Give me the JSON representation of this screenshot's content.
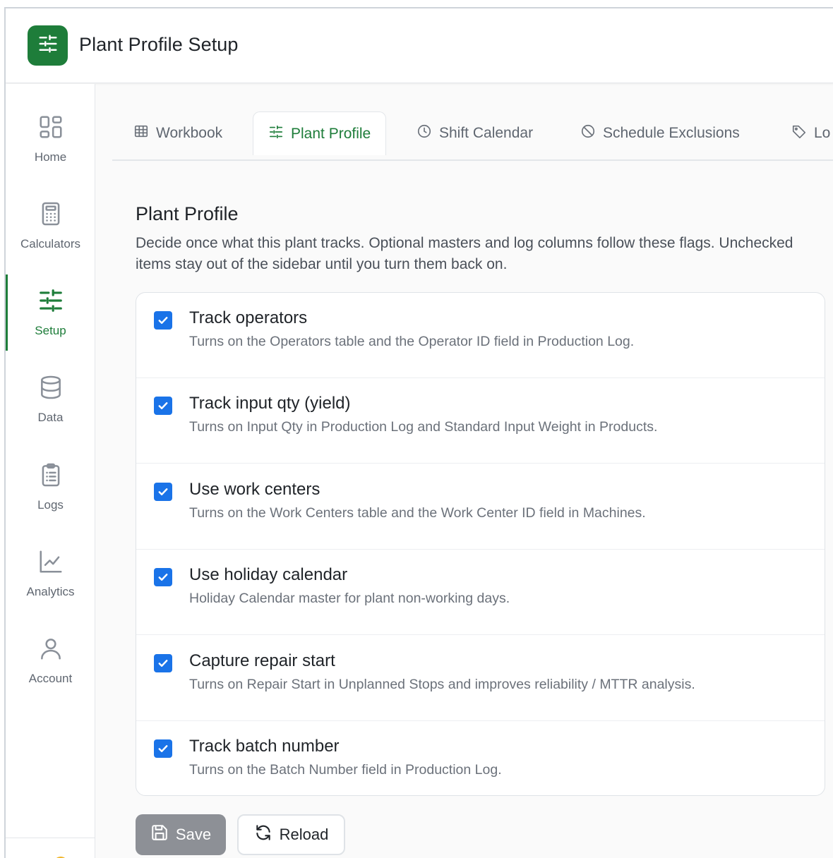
{
  "app": {
    "title": "Plant Profile Setup",
    "logo_icon": "sliders-icon",
    "accent_color": "#1e7d3a"
  },
  "sidebar": {
    "items": [
      {
        "label": "Home",
        "icon": "grid-icon",
        "active": false
      },
      {
        "label": "Calculators",
        "icon": "calculator-icon",
        "active": false
      },
      {
        "label": "Setup",
        "icon": "sliders-icon",
        "active": true
      },
      {
        "label": "Data",
        "icon": "database-icon",
        "active": false
      },
      {
        "label": "Logs",
        "icon": "clipboard-list-icon",
        "active": false
      },
      {
        "label": "Analytics",
        "icon": "line-chart-icon",
        "active": false
      },
      {
        "label": "Account",
        "icon": "user-icon",
        "active": false
      }
    ]
  },
  "tabs": [
    {
      "label": "Workbook",
      "icon": "table-icon",
      "active": false
    },
    {
      "label": "Plant Profile",
      "icon": "sliders-icon",
      "active": true
    },
    {
      "label": "Shift Calendar",
      "icon": "clock-icon",
      "active": false
    },
    {
      "label": "Schedule Exclusions",
      "icon": "ban-icon",
      "active": false
    },
    {
      "label": "Lo",
      "icon": "tag-icon",
      "active": false
    }
  ],
  "section": {
    "title": "Plant Profile",
    "description": "Decide once what this plant tracks. Optional masters and log columns follow these flags. Unchecked items stay out of the sidebar until you turn them back on."
  },
  "options": [
    {
      "title": "Track operators",
      "description": "Turns on the Operators table and the Operator ID field in Production Log.",
      "checked": true
    },
    {
      "title": "Track input qty (yield)",
      "description": "Turns on Input Qty in Production Log and Standard Input Weight in Products.",
      "checked": true
    },
    {
      "title": "Use work centers",
      "description": "Turns on the Work Centers table and the Work Center ID field in Machines.",
      "checked": true
    },
    {
      "title": "Use holiday calendar",
      "description": "Holiday Calendar master for plant non-working days.",
      "checked": true
    },
    {
      "title": "Capture repair start",
      "description": "Turns on Repair Start in Unplanned Stops and improves reliability / MTTR analysis.",
      "checked": true
    },
    {
      "title": "Track batch number",
      "description": "Turns on the Batch Number field in Production Log.",
      "checked": true
    }
  ],
  "actions": {
    "save_label": "Save",
    "reload_label": "Reload"
  }
}
